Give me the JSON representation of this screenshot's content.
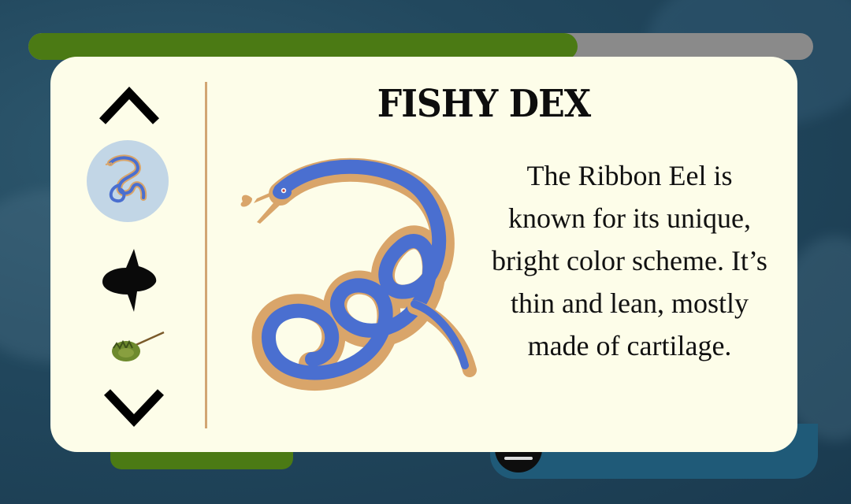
{
  "progress": {
    "fraction": 0.7
  },
  "dex": {
    "title": "FISHY DEX",
    "selected_index": 0,
    "entries": [
      {
        "name": "Ribbon Eel",
        "icon": "ribbon-eel-icon"
      },
      {
        "name": "Sunfish",
        "icon": "sunfish-silhouette-icon"
      },
      {
        "name": "Horseshoe Crab",
        "icon": "horseshoe-crab-icon"
      }
    ],
    "description": "The Ribbon Eel is known for its unique, bright color scheme. It’s thin and lean, mostly made of cartilage."
  },
  "colors": {
    "card_bg": "#fdfde9",
    "progress_fill": "#4b7a14",
    "progress_track": "#8a8a8a",
    "eel_blue": "#4a6fd0",
    "eel_tan": "#d9a56a",
    "selected_bg": "#c2d6e6"
  }
}
